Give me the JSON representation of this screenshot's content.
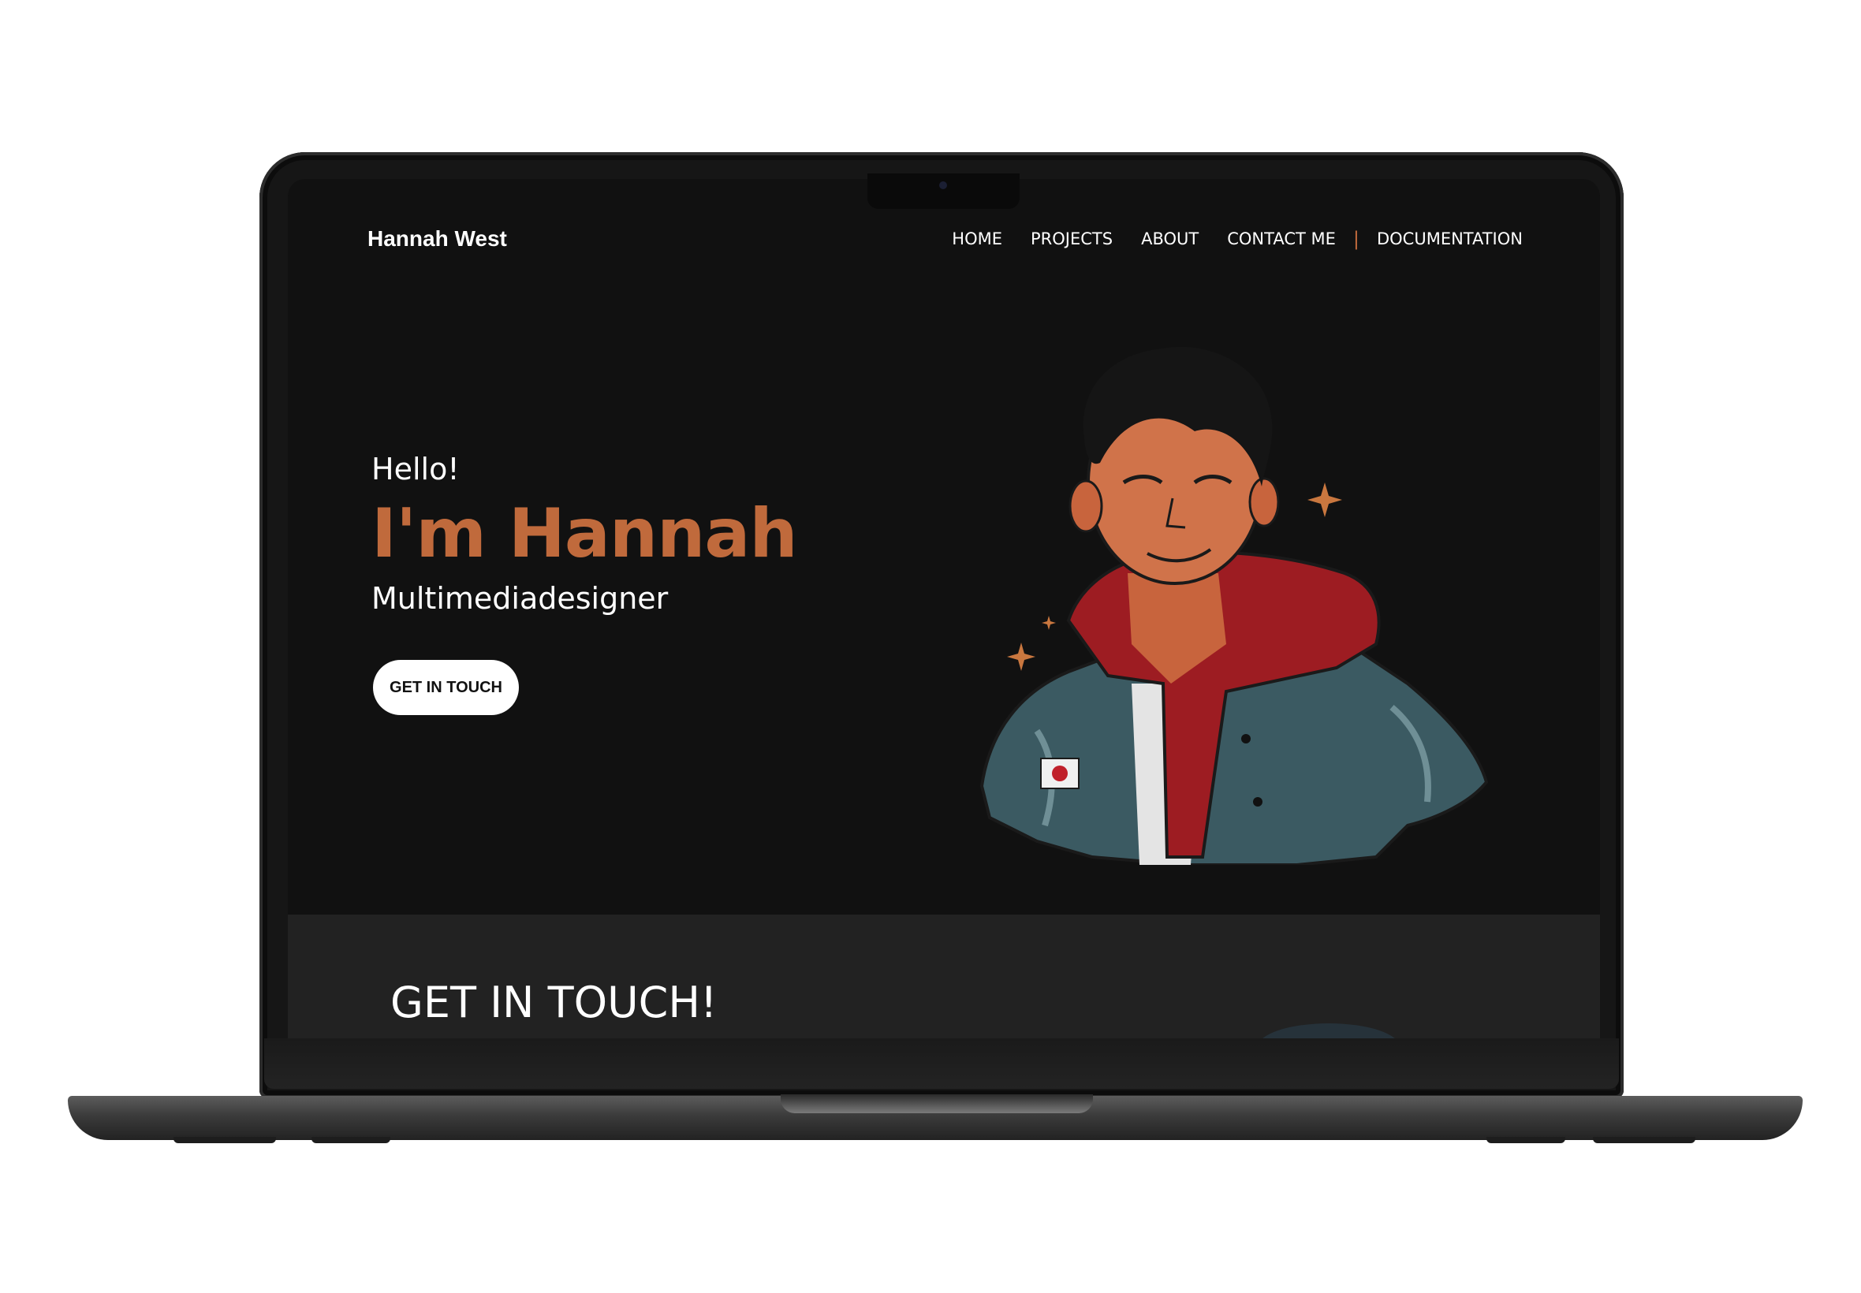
{
  "nav": {
    "brand": "Hannah West",
    "links": [
      "HOME",
      "PROJECTS",
      "ABOUT",
      "CONTACT ME"
    ],
    "divider": "|",
    "extra_link": "DOCUMENTATION"
  },
  "hero": {
    "greeting": "Hello!",
    "name": "I'm Hannah",
    "role": "Multimediadesigner",
    "cta_label": "GET IN TOUCH",
    "illustration_icon": "portrait-illustration"
  },
  "contact": {
    "title": "GET IN TOUCH!"
  },
  "colors": {
    "accent": "#c06a3c",
    "background": "#111111",
    "section_background": "#222222",
    "text": "#ffffff"
  }
}
